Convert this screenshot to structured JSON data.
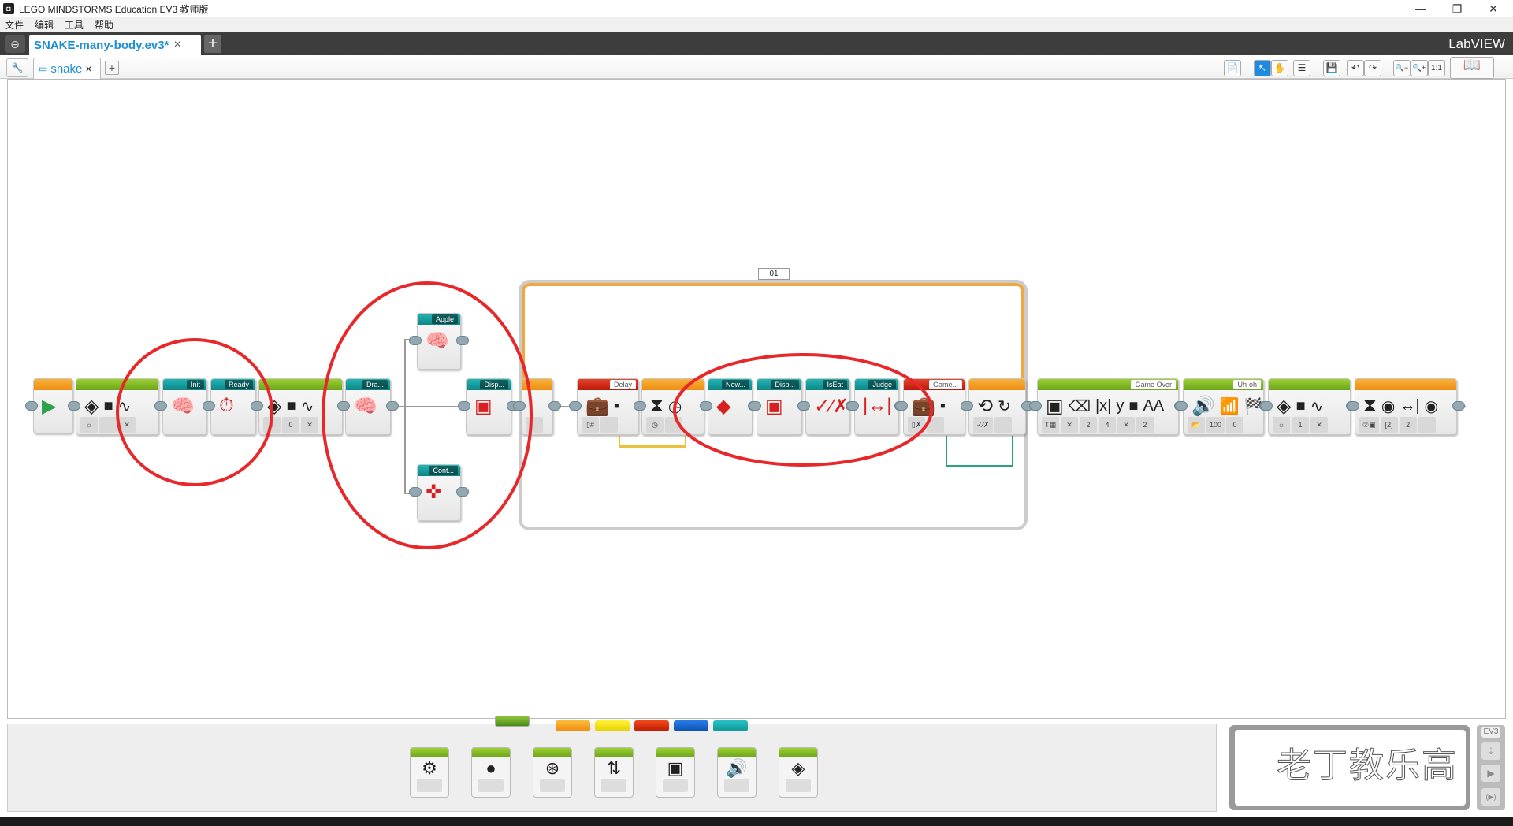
{
  "window": {
    "title": "LEGO MINDSTORMS Education EV3 教师版",
    "minimize": "—",
    "restore": "❐",
    "close": "✕"
  },
  "menu": [
    "文件",
    "编辑",
    "工具",
    "帮助"
  ],
  "project_tab": {
    "name": "SNAKE-many-body.ev3*",
    "close": "×",
    "add": "+",
    "brand": "LabVIEW"
  },
  "program_tab": {
    "name": "snake",
    "close": "×",
    "add": "+"
  },
  "toolbar": [
    "📄",
    "↖",
    "✋",
    "☰",
    "💾",
    "↶",
    "↷",
    "🔍−",
    "🔍+",
    "1:1",
    "📖"
  ],
  "loop": {
    "label": "01"
  },
  "colors": {
    "green": "#7ab827",
    "teal": "#16a3a3",
    "orange": "#f29a1f",
    "red": "#d9230f",
    "blue": "#1565c8",
    "yellow": "#f4e31a",
    "annotation": "#e8272a"
  },
  "blocks": [
    {
      "name": "start",
      "label": "",
      "color": "orange",
      "icons": [
        "▶"
      ],
      "params": []
    },
    {
      "name": "brick-status-light",
      "label": "",
      "color": "green",
      "icons": [
        "◈",
        "■",
        "∿"
      ],
      "params": [
        "☼",
        "",
        "✕"
      ]
    },
    {
      "name": "my-block-init",
      "label": "Init",
      "color": "teal",
      "icons": [
        "🧠"
      ],
      "params": []
    },
    {
      "name": "my-block-ready",
      "label": "Ready",
      "color": "teal",
      "icons": [
        "⏱"
      ],
      "params": []
    },
    {
      "name": "brick-status-light-2",
      "label": "",
      "color": "green",
      "icons": [
        "◈",
        "■",
        "∿"
      ],
      "params": [
        "☼",
        "0",
        "✕"
      ]
    },
    {
      "name": "my-block-draw",
      "label": "Dra...",
      "color": "teal",
      "icons": [
        "🧠"
      ],
      "params": []
    },
    {
      "name": "my-block-apple",
      "label": "Apple",
      "color": "teal",
      "icons": [
        "🧠"
      ],
      "params": []
    },
    {
      "name": "my-block-display",
      "label": "Disp...",
      "color": "teal",
      "icons": [
        "▣"
      ],
      "params": []
    },
    {
      "name": "my-block-control",
      "label": "Cont...",
      "color": "teal",
      "icons": [
        "✜"
      ],
      "params": []
    },
    {
      "name": "loop-start",
      "label": "",
      "color": "orange",
      "icons": [
        ""
      ],
      "params": [
        ""
      ]
    },
    {
      "name": "variable-delay",
      "label": "Delay",
      "color": "red",
      "icons": [
        "💼",
        "▪"
      ],
      "params": [
        "▯#",
        ""
      ]
    },
    {
      "name": "wait-timer",
      "label": "",
      "color": "orange",
      "icons": [
        "⧗",
        "◷"
      ],
      "params": [
        "◷",
        ""
      ]
    },
    {
      "name": "my-block-new",
      "label": "New...",
      "color": "teal",
      "icons": [
        "◆"
      ],
      "params": []
    },
    {
      "name": "my-block-display-2",
      "label": "Disp...",
      "color": "teal",
      "icons": [
        "▣"
      ],
      "params": []
    },
    {
      "name": "my-block-iseat",
      "label": "IsEat",
      "color": "teal",
      "icons": [
        "✓⁄✗"
      ],
      "params": []
    },
    {
      "name": "my-block-judge",
      "label": "Judge",
      "color": "teal",
      "icons": [
        "|↔|"
      ],
      "params": []
    },
    {
      "name": "variable-game",
      "label": "Game...",
      "color": "red",
      "icons": [
        "💼",
        "▪"
      ],
      "params": [
        "▯✗",
        ""
      ]
    },
    {
      "name": "loop-end",
      "label": "",
      "color": "orange",
      "icons": [
        "⟲",
        "↻"
      ],
      "params": [
        "✓⁄✗",
        ""
      ]
    },
    {
      "name": "display-game-over",
      "label": "Game Over",
      "color": "green",
      "icons": [
        "▣",
        "⌫",
        "|x|",
        "y",
        "■",
        "AA"
      ],
      "params": [
        "T▦",
        "✕",
        "2",
        "4",
        "✕",
        "2"
      ]
    },
    {
      "name": "sound-uh-oh",
      "label": "Uh-oh",
      "color": "green",
      "icons": [
        "🔊",
        "📶",
        "🏁"
      ],
      "params": [
        "📂",
        "100",
        "0"
      ]
    },
    {
      "name": "brick-status-light-3",
      "label": "",
      "color": "green",
      "icons": [
        "◈",
        "■",
        "∿"
      ],
      "params": [
        "☼",
        "1",
        "✕"
      ]
    },
    {
      "name": "wait-button",
      "label": "",
      "color": "orange",
      "icons": [
        "⧗",
        "◉",
        "↔|",
        "◉"
      ],
      "params": [
        "②▣",
        "[2]",
        "2",
        ""
      ]
    }
  ],
  "palette_tabs": [
    "green",
    "orange",
    "yellow",
    "red",
    "blue",
    "teal"
  ],
  "palette_blocks": [
    {
      "name": "medium-motor",
      "icon": "⚙"
    },
    {
      "name": "large-motor",
      "icon": "●"
    },
    {
      "name": "move-steering",
      "icon": "⊛"
    },
    {
      "name": "move-tank",
      "icon": "⇅"
    },
    {
      "name": "display",
      "icon": "▣"
    },
    {
      "name": "sound",
      "icon": "🔊"
    },
    {
      "name": "brick-status-light",
      "icon": "◈"
    }
  ],
  "hardware": {
    "brand": "EV3",
    "download": "⇣",
    "run": "▶",
    "run-selected": "(▶)"
  },
  "watermark": "老丁教乐高"
}
